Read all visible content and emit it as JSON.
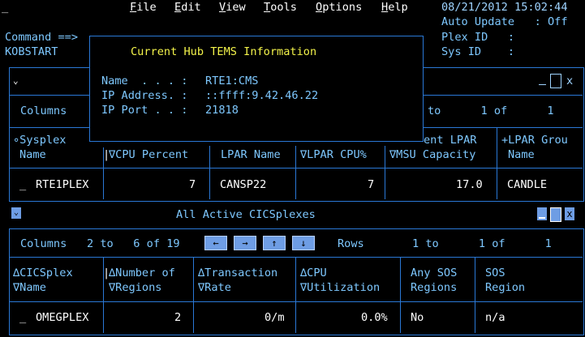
{
  "menu": {
    "items": [
      {
        "key": "F",
        "rest": "ile"
      },
      {
        "key": "E",
        "rest": "dit"
      },
      {
        "key": "V",
        "rest": "iew"
      },
      {
        "key": "T",
        "rest": "ools"
      },
      {
        "key": "O",
        "rest": "ptions"
      },
      {
        "key": "H",
        "rest": "elp"
      }
    ],
    "prefix": "_"
  },
  "status": {
    "datetime": "08/21/2012 15:02:44",
    "auto_update": "Auto Update   : Off",
    "plex_id": "Plex ID   :",
    "sys_id": "Sys ID    :"
  },
  "command": {
    "label": "Command ==>",
    "program": "KOBSTART"
  },
  "popup": {
    "title": "Current Hub TEMS Information",
    "fields": [
      {
        "label": "Name  . . . :",
        "value": "RTE1:CMS"
      },
      {
        "label": "IP Address. :",
        "value": "::ffff:9.42.46.22"
      },
      {
        "label": "IP Port . . :",
        "value": "21818"
      }
    ]
  },
  "top_panel": {
    "columns_label": "Columns",
    "rows_partial": "to      1 of      1",
    "headers": [
      {
        "line1": "∘Sysplex",
        "line2": "Name"
      },
      {
        "line1": "",
        "line2": "∇CPU Percent"
      },
      {
        "line1": "",
        "line2": "LPAR Name"
      },
      {
        "line1": "",
        "line2": "∇LPAR CPU%"
      },
      {
        "line1": "ent LPAR",
        "line2": "∇MSU Capacity"
      },
      {
        "line1": "+LPAR Grou",
        "line2": "Name"
      }
    ],
    "row": {
      "select": "_",
      "sysplex": "RTE1PLEX",
      "cpu": "7",
      "lpar": "CANSP22",
      "lpar_cpu": "7",
      "msu": "17.0",
      "group": "CANDLE"
    }
  },
  "bottom_panel": {
    "title": "All Active CICSplexes",
    "columns_label": "Columns",
    "columns_range": "2 to   6 of 19",
    "nav_buttons": [
      "←",
      "→",
      "↑",
      "↓"
    ],
    "rows_label": "Rows",
    "rows_range": "1 to      1 of      1",
    "headers": [
      {
        "line1": "∆CICSplex",
        "line2": "∇Name"
      },
      {
        "line1": "∆Number of",
        "line2": "∇Regions"
      },
      {
        "line1": "∆Transaction",
        "line2": "∇Rate"
      },
      {
        "line1": "∆CPU",
        "line2": "∇Utilization"
      },
      {
        "line1": "Any SOS",
        "line2": "Regions"
      },
      {
        "line1": "SOS",
        "line2": "Region"
      }
    ],
    "row": {
      "select": "_",
      "name": "OMEGPLEX",
      "regions": "2",
      "rate": "0/m",
      "cpu": "0.0%",
      "any_sos": "No",
      "sos_region": "n/a"
    }
  },
  "colors": {
    "background": "#000000",
    "text": "#7ec8ff",
    "border": "#2a78d6",
    "highlight": "#ffffff",
    "title": "#f3f34a"
  }
}
